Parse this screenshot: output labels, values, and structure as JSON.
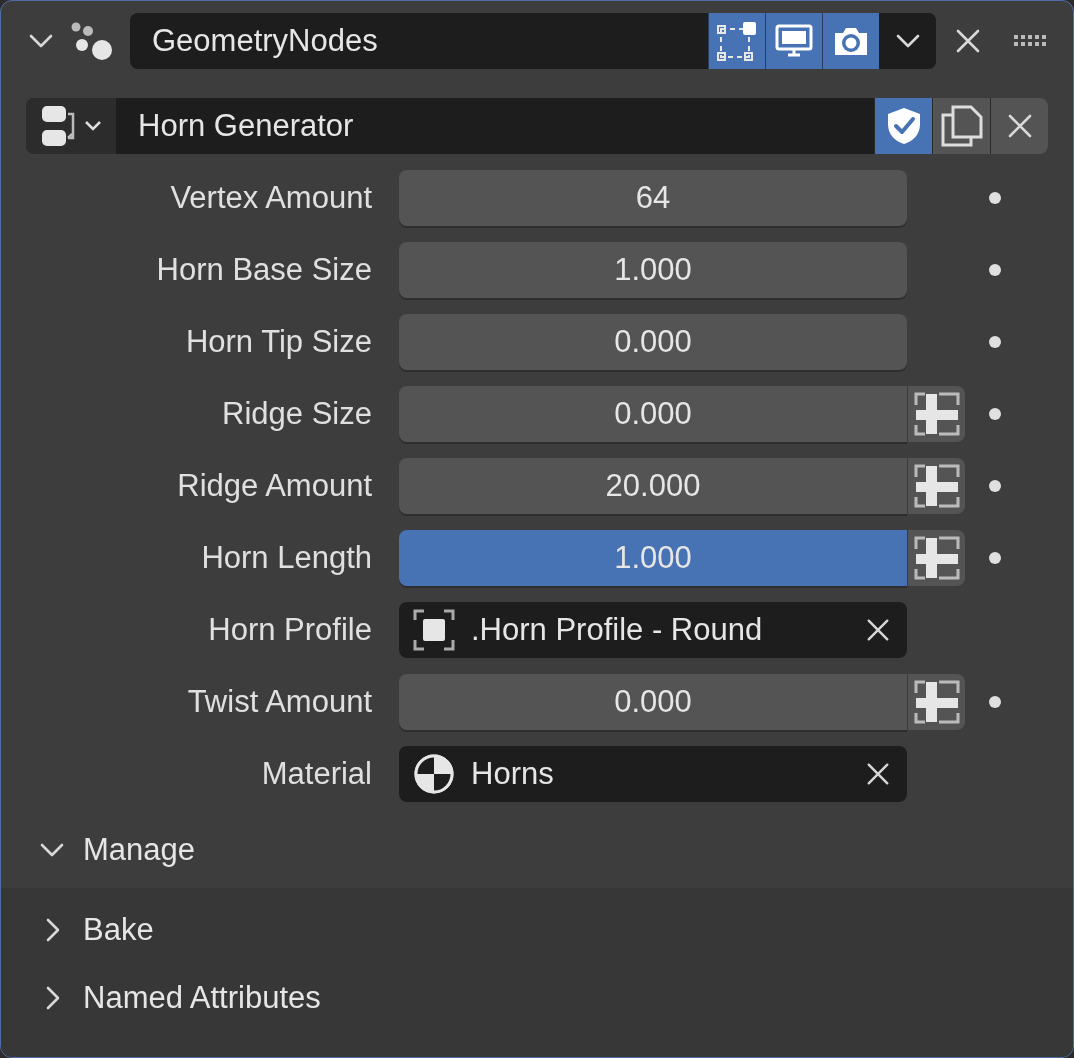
{
  "modifier": {
    "expanded": true,
    "name": "GeometryNodes",
    "toggles": [
      {
        "kind": "editmode",
        "on": true
      },
      {
        "kind": "viewport",
        "on": true
      },
      {
        "kind": "render",
        "on": true
      }
    ]
  },
  "node_group": {
    "name": "Horn Generator",
    "fake_user": true
  },
  "params": [
    {
      "kind": "number",
      "label": "Vertex Amount",
      "value": "64",
      "selected": false,
      "attribute_toggle": false
    },
    {
      "kind": "number",
      "label": "Horn Base Size",
      "value": "1.000",
      "selected": false,
      "attribute_toggle": false
    },
    {
      "kind": "number",
      "label": "Horn Tip Size",
      "value": "0.000",
      "selected": false,
      "attribute_toggle": false
    },
    {
      "kind": "number",
      "label": "Ridge Size",
      "value": "0.000",
      "selected": false,
      "attribute_toggle": true
    },
    {
      "kind": "number",
      "label": "Ridge Amount",
      "value": "20.000",
      "selected": false,
      "attribute_toggle": true
    },
    {
      "kind": "number",
      "label": "Horn Length",
      "value": "1.000",
      "selected": true,
      "attribute_toggle": true
    },
    {
      "kind": "object",
      "label": "Horn Profile",
      "value": ".Horn Profile - Round"
    },
    {
      "kind": "number",
      "label": "Twist Amount",
      "value": "0.000",
      "selected": false,
      "attribute_toggle": true
    },
    {
      "kind": "material",
      "label": "Material",
      "value": "Horns"
    }
  ],
  "sections": [
    {
      "label": "Manage",
      "expanded": true,
      "nested": false
    },
    {
      "label": "Bake",
      "expanded": false,
      "nested": true
    },
    {
      "label": "Named Attributes",
      "expanded": false,
      "nested": true
    }
  ]
}
